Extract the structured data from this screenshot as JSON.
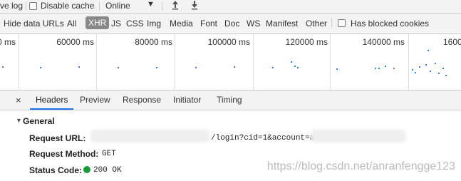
{
  "toolbar": {
    "preserve_log_label": "ve log",
    "disable_cache_label": "Disable cache",
    "throttle_value": "Online",
    "upload_icon": "upload-icon",
    "download_icon": "download-icon"
  },
  "filters": {
    "hide_data_urls": "Hide data URLs",
    "types": [
      "All",
      "XHR",
      "JS",
      "CSS",
      "Img",
      "Media",
      "Font",
      "Doc",
      "WS",
      "Manifest",
      "Other"
    ],
    "active_type": "XHR",
    "has_blocked_cookies": "Has blocked cookies"
  },
  "overview": {
    "ticks": [
      "0 ms",
      "60000 ms",
      "80000 ms",
      "100000 ms",
      "120000 ms",
      "140000 ms",
      "1600"
    ]
  },
  "details": {
    "tabs": [
      "Headers",
      "Preview",
      "Response",
      "Initiator",
      "Timing"
    ],
    "active_tab": "Headers",
    "section_title": "General",
    "rows": {
      "request_url_label": "Request URL:",
      "request_url_value": "/login?cid=1&account=ad",
      "request_method_label": "Request Method:",
      "request_method_value": "GET",
      "status_code_label": "Status Code:",
      "status_code_value": "200 OK"
    },
    "status_color": "#1a9b3a"
  },
  "watermark": "https://blog.csdn.net/anranfengge123"
}
